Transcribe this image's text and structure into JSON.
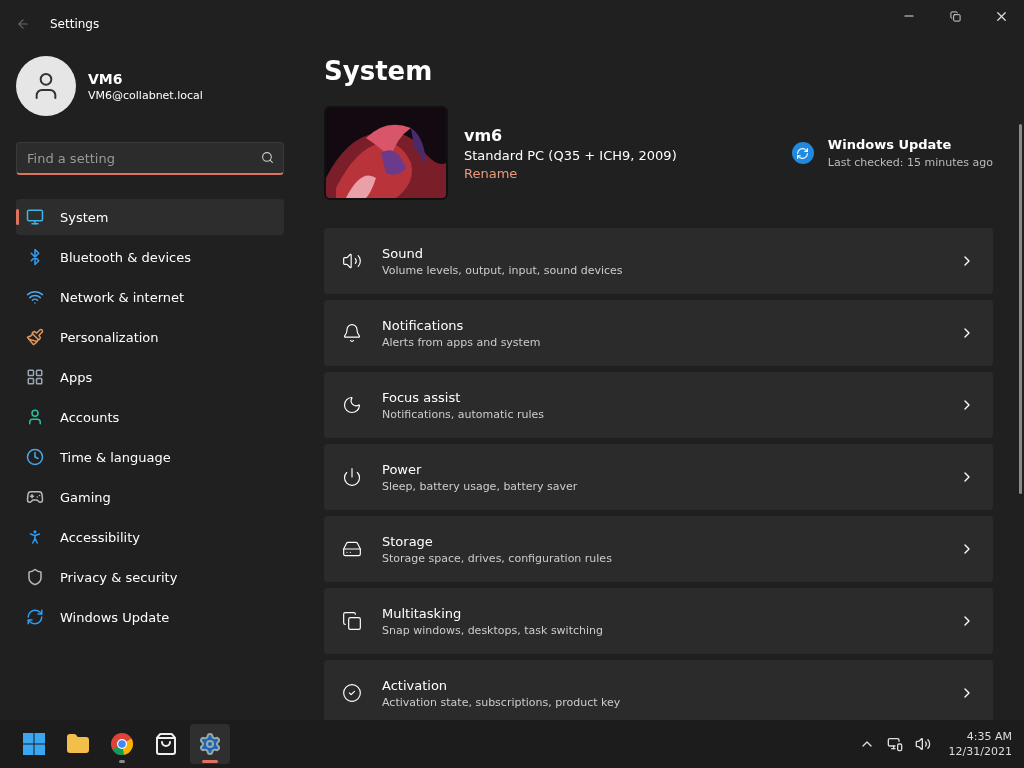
{
  "window": {
    "title": "Settings"
  },
  "account": {
    "name": "VM6",
    "email": "VM6@collabnet.local"
  },
  "search": {
    "placeholder": "Find a setting"
  },
  "sidebar": {
    "items": [
      {
        "label": "System",
        "selected": true
      },
      {
        "label": "Bluetooth & devices",
        "selected": false
      },
      {
        "label": "Network & internet",
        "selected": false
      },
      {
        "label": "Personalization",
        "selected": false
      },
      {
        "label": "Apps",
        "selected": false
      },
      {
        "label": "Accounts",
        "selected": false
      },
      {
        "label": "Time & language",
        "selected": false
      },
      {
        "label": "Gaming",
        "selected": false
      },
      {
        "label": "Accessibility",
        "selected": false
      },
      {
        "label": "Privacy & security",
        "selected": false
      },
      {
        "label": "Windows Update",
        "selected": false
      }
    ]
  },
  "page": {
    "title": "System"
  },
  "device": {
    "name": "vm6",
    "model": "Standard PC (Q35 + ICH9, 2009)",
    "rename": "Rename"
  },
  "update": {
    "title": "Windows Update",
    "status": "Last checked: 15 minutes ago"
  },
  "settings": [
    {
      "title": "Sound",
      "description": "Volume levels, output, input, sound devices"
    },
    {
      "title": "Notifications",
      "description": "Alerts from apps and system"
    },
    {
      "title": "Focus assist",
      "description": "Notifications, automatic rules"
    },
    {
      "title": "Power",
      "description": "Sleep, battery usage, battery saver"
    },
    {
      "title": "Storage",
      "description": "Storage space, drives, configuration rules"
    },
    {
      "title": "Multitasking",
      "description": "Snap windows, desktops, task switching"
    },
    {
      "title": "Activation",
      "description": "Activation state, subscriptions, product key"
    }
  ],
  "taskbar": {
    "apps": [
      {
        "selected": false,
        "running": false
      },
      {
        "selected": false,
        "running": false
      },
      {
        "selected": false,
        "running": true
      },
      {
        "selected": false,
        "running": false
      },
      {
        "selected": true,
        "running": true
      }
    ],
    "time": "4:35 AM",
    "date": "12/31/2021"
  }
}
